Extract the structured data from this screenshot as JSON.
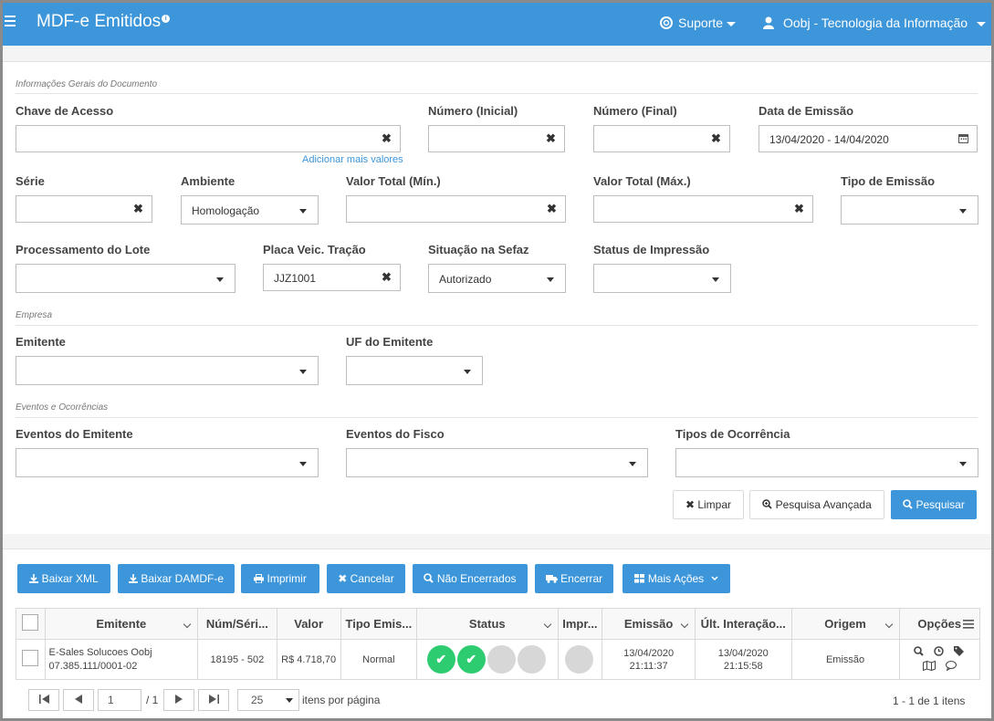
{
  "header": {
    "title": "MDF-e Emitidos",
    "info_badge": "i",
    "support": "Suporte",
    "user": "Oobj - Tecnologia da Informação"
  },
  "form": {
    "section_general": "Informações Gerais do Documento",
    "chave_label": "Chave de Acesso",
    "add_more": "Adicionar mais valores",
    "numero_inicial_label": "Número (Inicial)",
    "numero_final_label": "Número (Final)",
    "data_emissao_label": "Data de Emissão",
    "data_emissao_value": "13/04/2020 - 14/04/2020",
    "serie_label": "Série",
    "ambiente_label": "Ambiente",
    "ambiente_value": "Homologação",
    "valor_min_label": "Valor Total (Mín.)",
    "valor_max_label": "Valor Total (Máx.)",
    "tipo_emissao_label": "Tipo de Emissão",
    "proc_lote_label": "Processamento do Lote",
    "placa_label": "Placa Veic. Tração",
    "placa_value": "JJZ1001",
    "situacao_label": "Situação na Sefaz",
    "situacao_value": "Autorizado",
    "status_impressao_label": "Status de Impressão",
    "section_empresa": "Empresa",
    "emitente_label": "Emitente",
    "uf_label": "UF do Emitente",
    "section_eventos": "Eventos e Ocorrências",
    "eventos_emitente_label": "Eventos do Emitente",
    "eventos_fisco_label": "Eventos do Fisco",
    "tipos_ocorrencia_label": "Tipos de Ocorrência",
    "clear_x": "✖"
  },
  "buttons": {
    "limpar": "✖ Limpar",
    "pesquisa_avancada": "Pesquisa Avançada",
    "pesquisar": "Pesquisar"
  },
  "toolbar": {
    "baixar_xml": "Baixar XML",
    "baixar_damdfe": "Baixar DAMDF-e",
    "imprimir": "Imprimir",
    "cancelar": "✖ Cancelar",
    "nao_encerrados": "Não Encerrados",
    "encerrar": "Encerrar",
    "mais_acoes": "Mais Ações"
  },
  "table": {
    "columns": [
      "Emitente",
      "Núm/Séri...",
      "Valor",
      "Tipo Emis...",
      "Status",
      "Impr...",
      "Emissão",
      "Últ. Interação...",
      "Origem",
      "Opções"
    ],
    "row": {
      "emitente_name": "E-Sales Solucoes Oobj",
      "emitente_cnpj": "07.385.111/0001-02",
      "num_serie": "18195 - 502",
      "valor": "R$ 4.718,70",
      "tipo_emissao": "Normal",
      "status_ok_glyph": "✔",
      "emissao_date": "13/04/2020",
      "emissao_time": "21:11:37",
      "ult_date": "13/04/2020",
      "ult_time": "21:15:58",
      "origem": "Emissão"
    }
  },
  "pagination": {
    "page": "1",
    "of_pages": "/ 1",
    "per_page": "25",
    "per_page_label": "itens por página",
    "summary": "1 - 1 de 1 itens"
  },
  "colors": {
    "primary": "#3d96da",
    "ok": "#2ecc71"
  }
}
